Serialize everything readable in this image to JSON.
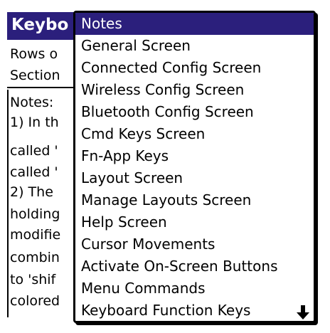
{
  "app": {
    "title": "Keybo",
    "lines": [
      "Rows o",
      "Section",
      "Notes:",
      "1) In th",
      "called '",
      "called '",
      "2) The",
      "holding",
      "modifie",
      "combin",
      "to 'shif",
      "colored"
    ]
  },
  "menu": {
    "items": [
      "Notes",
      "General Screen",
      "Connected Config Screen",
      "Wireless Config Screen",
      "Bluetooth Config Screen",
      "Cmd Keys Screen",
      "Fn-App Keys",
      "Layout Screen",
      "Manage Layouts Screen",
      "Help Screen",
      "Cursor Movements",
      "Activate On-Screen Buttons",
      "Menu Commands",
      "Keyboard Function Keys"
    ],
    "selected_index": 0
  },
  "icons": {
    "scroll": "down-arrow-icon"
  },
  "colors": {
    "selection": "#2b1f7c",
    "text": "#000000",
    "background": "#ffffff"
  }
}
